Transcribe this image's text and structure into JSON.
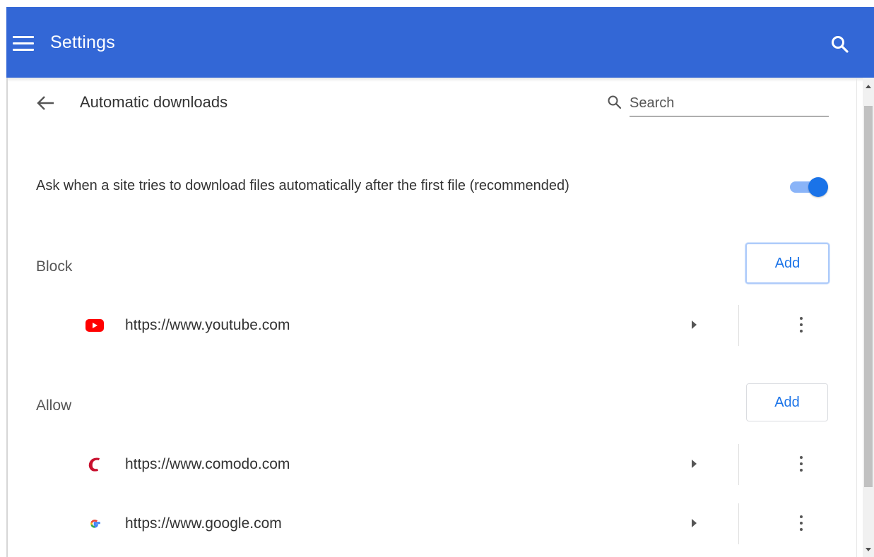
{
  "header": {
    "title": "Settings",
    "menu_icon": "hamburger-menu-icon",
    "search_icon": "search-icon",
    "color": "#3367d6"
  },
  "page": {
    "title": "Automatic downloads",
    "back_icon": "back-arrow-icon",
    "search": {
      "placeholder": "Search",
      "value": ""
    }
  },
  "setting": {
    "label": "Ask when a site tries to download files automatically after the first file (recommended)",
    "enabled": true,
    "accent": "#1a73e8"
  },
  "block": {
    "label": "Block",
    "add_label": "Add",
    "sites": [
      {
        "url": "https://www.youtube.com",
        "icon": "youtube-icon"
      }
    ]
  },
  "allow": {
    "label": "Allow",
    "add_label": "Add",
    "sites": [
      {
        "url": "https://www.comodo.com",
        "icon": "comodo-icon"
      },
      {
        "url": "https://www.google.com",
        "icon": "google-icon"
      }
    ]
  }
}
